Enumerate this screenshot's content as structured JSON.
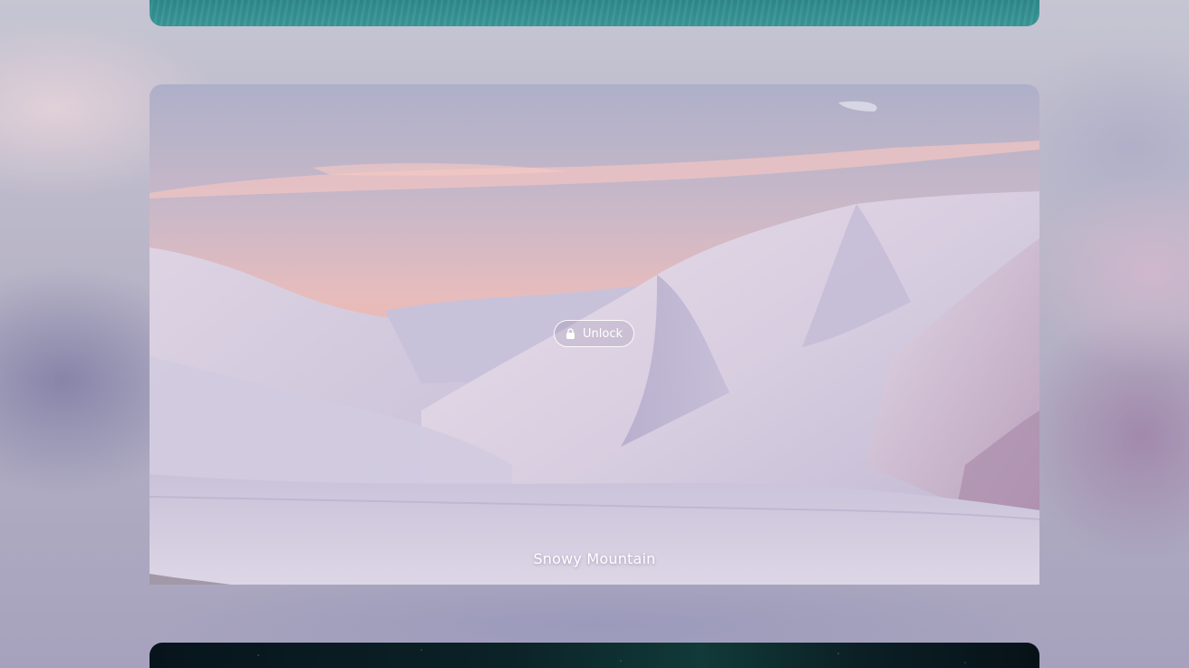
{
  "cards": {
    "current": {
      "title": "Snowy Mountain",
      "unlock_label": "Unlock",
      "unlock_icon": "lock-icon"
    }
  },
  "colors": {
    "sky_top": "#b4b3cb",
    "sky_glow": "#e9b4b4",
    "snow": "#e8e4f0",
    "shadow_snow": "#b9b3d0"
  }
}
